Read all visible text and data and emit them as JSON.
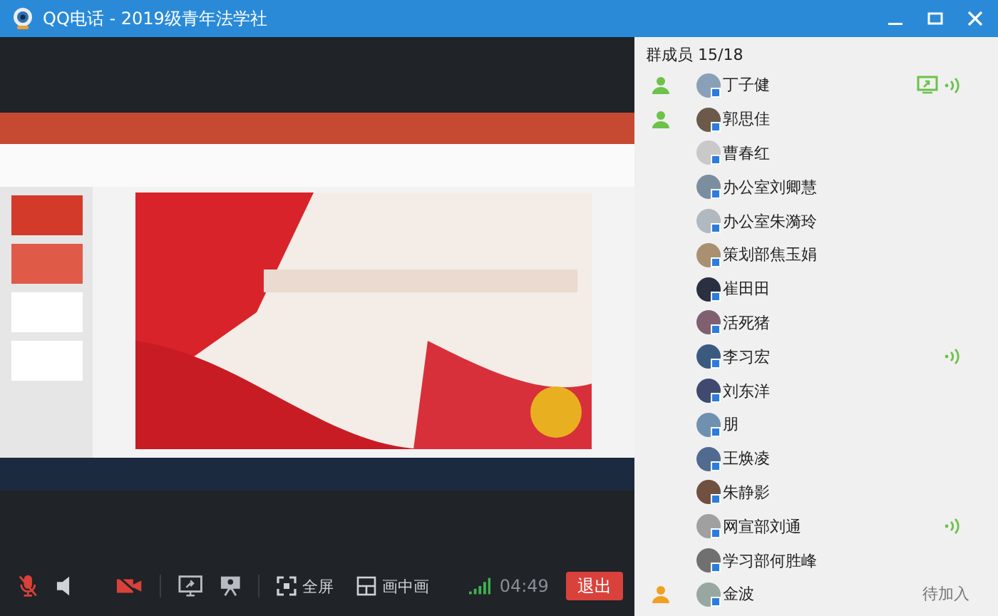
{
  "window": {
    "title": "QQ电话 - 2019级青年法学社"
  },
  "toolbar": {
    "mic_muted": true,
    "camera_on": false,
    "fullscreen": "全屏",
    "pip": "画中画",
    "duration": "04:49",
    "exit": "退出"
  },
  "members": {
    "title": "群成员 15/18",
    "items": [
      {
        "name": "丁子健",
        "color": "#6cc24a",
        "screen_sharing": true,
        "speaking": true
      },
      {
        "name": "郭思佳",
        "color": "#6cc24a",
        "screen_sharing": false,
        "speaking": false
      },
      {
        "name": "曹春红",
        "screen_sharing": false,
        "speaking": false
      },
      {
        "name": "办公室刘卿慧",
        "screen_sharing": false,
        "speaking": false
      },
      {
        "name": "办公室朱漪玲",
        "screen_sharing": false,
        "speaking": false
      },
      {
        "name": "策划部焦玉娟",
        "screen_sharing": false,
        "speaking": false
      },
      {
        "name": "崔田田",
        "screen_sharing": false,
        "speaking": false
      },
      {
        "name": "活死猪",
        "screen_sharing": false,
        "speaking": false
      },
      {
        "name": "李习宏",
        "screen_sharing": false,
        "speaking": true
      },
      {
        "name": "刘东洋",
        "screen_sharing": false,
        "speaking": false
      },
      {
        "name": "朋",
        "screen_sharing": false,
        "speaking": false
      },
      {
        "name": "王焕凌",
        "screen_sharing": false,
        "speaking": false
      },
      {
        "name": "朱静影",
        "screen_sharing": false,
        "speaking": false
      },
      {
        "name": "网宣部刘通",
        "screen_sharing": false,
        "speaking": true
      },
      {
        "name": "学习部何胜峰",
        "screen_sharing": false,
        "speaking": false
      },
      {
        "name": "金波",
        "color": "#f0a020",
        "screen_sharing": false,
        "speaking": false,
        "status": "待加入"
      }
    ]
  }
}
